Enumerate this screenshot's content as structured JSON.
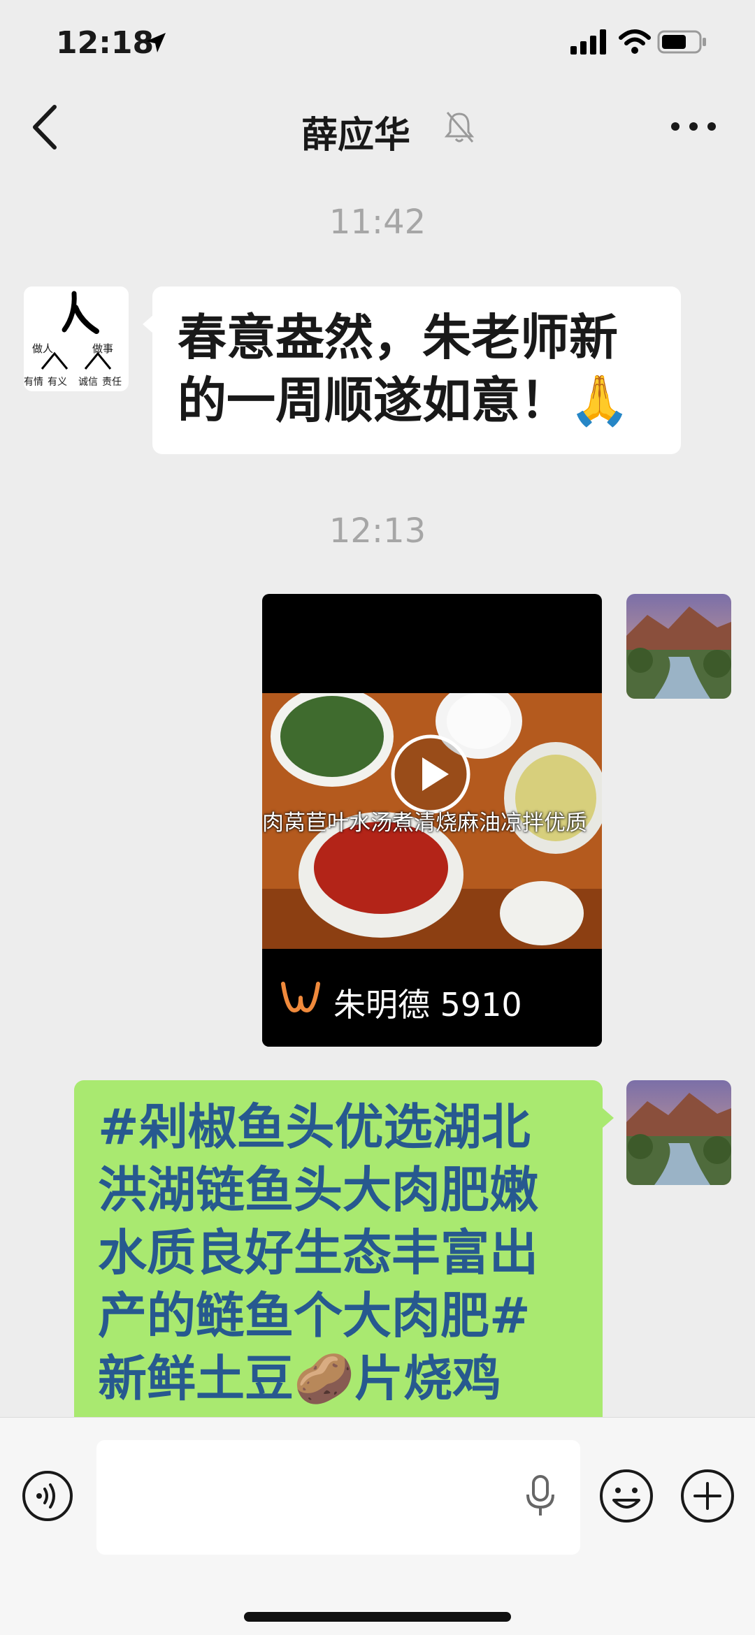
{
  "status_bar": {
    "time": "12:18"
  },
  "nav": {
    "title": "薛应华"
  },
  "messages": [
    {
      "type": "timestamp",
      "text": "11:42"
    },
    {
      "type": "text",
      "side": "left",
      "text": "春意盎然，朱老师新的一周顺遂如意！🙏",
      "lines": [
        "春意盎然，朱老师新",
        "的一周顺遂如意！"
      ],
      "emoji": "🙏",
      "avatar_text": {
        "top": "做人",
        "top_right": "做事",
        "bottom": [
          "有情",
          "有义",
          "诚信",
          "责任"
        ]
      }
    },
    {
      "type": "timestamp",
      "text": "12:13"
    },
    {
      "type": "video",
      "side": "right",
      "caption": "肉莴苣叶水汤煮清烧麻油凉拌优质",
      "channel": "朱明德 5910"
    },
    {
      "type": "text",
      "side": "right",
      "lines": [
        "#剁椒鱼头优选湖北",
        "洪湖链鱼头大肉肥嫩",
        "水质良好生态丰富出",
        "产的鲢鱼个大肉肥#",
        "新鲜土豆",
        "片烧鸡"
      ],
      "emoji": "🥔"
    }
  ],
  "input": {
    "value": "",
    "placeholder": ""
  },
  "colors": {
    "self_bubble": "#a9e970",
    "other_bubble": "#ffffff",
    "background": "#ededed"
  }
}
